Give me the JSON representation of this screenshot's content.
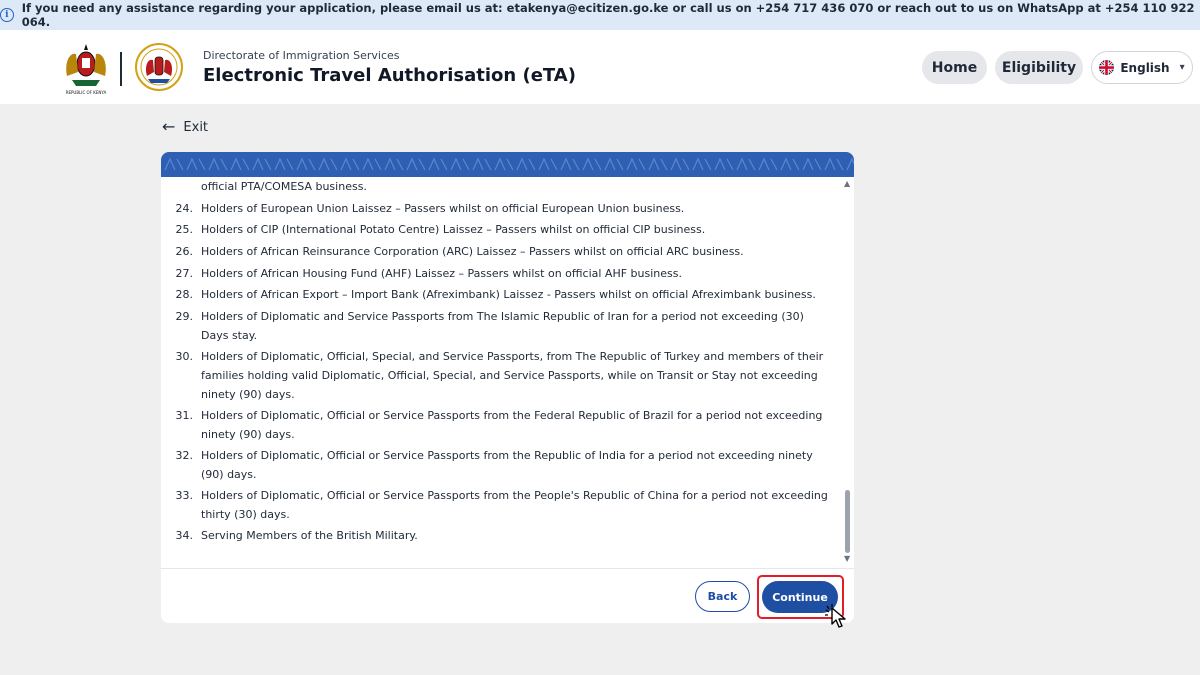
{
  "banner": {
    "text": "If you need any assistance regarding your application, please email us at: etakenya@ecitizen.go.ke or call us on +254 717 436 070 or reach out to us on WhatsApp at +254 110 922 064."
  },
  "header": {
    "logo_caption": "REPUBLIC OF KENYA",
    "subtitle": "Directorate of Immigration Services",
    "title": "Electronic Travel Authorisation (eTA)",
    "nav": {
      "home": "Home",
      "eligibility": "Eligibility"
    },
    "language": "English"
  },
  "exit_label": "Exit",
  "list": [
    {
      "num": "",
      "text": "official PTA/COMESA business."
    },
    {
      "num": "24.",
      "text": "Holders of European Union Laissez – Passers whilst on official European Union business."
    },
    {
      "num": "25.",
      "text": "Holders of CIP (International Potato Centre) Laissez – Passers whilst on official CIP business."
    },
    {
      "num": "26.",
      "text": "Holders of African Reinsurance Corporation (ARC) Laissez – Passers whilst on official ARC business."
    },
    {
      "num": "27.",
      "text": "Holders of African Housing Fund (AHF) Laissez – Passers whilst on official AHF business."
    },
    {
      "num": "28.",
      "text": "Holders of African Export – Import Bank (Afreximbank) Laissez - Passers whilst on official Afreximbank business."
    },
    {
      "num": "29.",
      "text": "Holders of Diplomatic and Service Passports from The Islamic Republic of Iran for a period not exceeding (30) Days stay."
    },
    {
      "num": "30.",
      "text": "Holders of Diplomatic, Official, Special, and Service Passports, from The Republic of Turkey and members of their families holding valid Diplomatic, Official, Special, and Service Passports, while on Transit or Stay not exceeding ninety (90) days."
    },
    {
      "num": "31.",
      "text": "Holders of Diplomatic, Official or Service Passports from the Federal Republic of Brazil for a period not exceeding ninety (90) days."
    },
    {
      "num": "32.",
      "text": "Holders of Diplomatic, Official or Service Passports from the Republic of India for a period not exceeding ninety (90) days."
    },
    {
      "num": "33.",
      "text": "Holders of Diplomatic, Official or Service Passports from the People's Republic of China for a period not exceeding thirty (30) days."
    },
    {
      "num": "34.",
      "text": "Serving Members of the British Military."
    }
  ],
  "buttons": {
    "back": "Back",
    "continue": "Continue"
  },
  "colors": {
    "primary": "#1e4fa3",
    "highlight": "#e11d2a",
    "banner_bg": "#dde9f6",
    "pattern": "#2f5fb3"
  }
}
